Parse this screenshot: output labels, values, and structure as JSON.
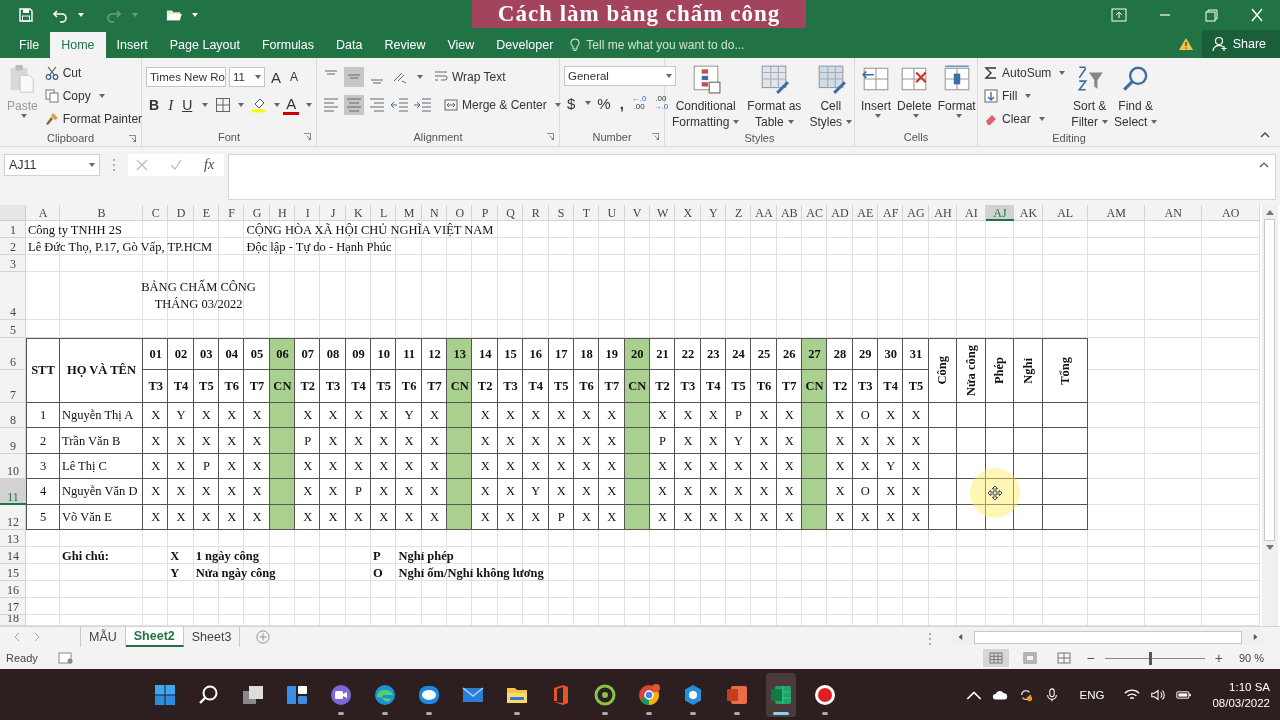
{
  "overlay_title": "Cách làm bảng chấm công",
  "tabs": [
    {
      "label": "File",
      "selected": false
    },
    {
      "label": "Home",
      "selected": true
    },
    {
      "label": "Insert",
      "selected": false
    },
    {
      "label": "Page Layout",
      "selected": false
    },
    {
      "label": "Formulas",
      "selected": false
    },
    {
      "label": "Data",
      "selected": false
    },
    {
      "label": "Review",
      "selected": false
    },
    {
      "label": "View",
      "selected": false
    },
    {
      "label": "Developer",
      "selected": false
    }
  ],
  "tell_me": {
    "placeholder": "Tell me what you want to do..."
  },
  "share": "Share",
  "clipboard": {
    "paste": "Paste",
    "cut": "Cut",
    "copy": "Copy",
    "format_painter": "Format Painter",
    "label": "Clipboard"
  },
  "font": {
    "family": "Times New Ro",
    "size": "11",
    "grow": "A",
    "shrink": "A",
    "bold": "B",
    "italic": "I",
    "underline": "U",
    "font_color_letter": "A",
    "label": "Font"
  },
  "alignment": {
    "vertical": [
      {
        "selected": false
      },
      {
        "selected": true
      },
      {
        "selected": false
      }
    ],
    "horizontal": [
      {
        "selected": false
      },
      {
        "selected": true
      },
      {
        "selected": false
      }
    ],
    "wrap_text": "Wrap Text",
    "merge": "Merge & Center",
    "label": "Alignment"
  },
  "number": {
    "format": "General",
    "currency": "$",
    "percent": "%",
    "comma": ",",
    "increase_decimal": [
      "←.0",
      ".00"
    ],
    "decrease_decimal": [
      ".00",
      "→.0"
    ],
    "label": "Number"
  },
  "styles": {
    "items": [
      {
        "lines": [
          "Conditional",
          "Formatting"
        ]
      },
      {
        "lines": [
          "Format as",
          "Table"
        ]
      },
      {
        "lines": [
          "Cell",
          "Styles"
        ]
      }
    ],
    "label": "Styles"
  },
  "cells": {
    "items": [
      "Insert",
      "Delete",
      "Format"
    ],
    "label": "Cells"
  },
  "editing": {
    "autosum": "AutoSum",
    "fill": "Fill",
    "clear": "Clear",
    "sort": [
      "Sort &",
      "Filter"
    ],
    "find": [
      "Find &",
      "Select"
    ],
    "label": "Editing"
  },
  "formula_bar": {
    "name_box": "AJ11",
    "fx": "fx"
  },
  "columns": [
    {
      "label": "A",
      "selected": false
    },
    {
      "label": "B",
      "selected": false
    },
    {
      "label": "C",
      "selected": false
    },
    {
      "label": "D",
      "selected": false
    },
    {
      "label": "E",
      "selected": false
    },
    {
      "label": "F",
      "selected": false
    },
    {
      "label": "G",
      "selected": false
    },
    {
      "label": "H",
      "selected": false
    },
    {
      "label": "I",
      "selected": false
    },
    {
      "label": "J",
      "selected": false
    },
    {
      "label": "K",
      "selected": false
    },
    {
      "label": "L",
      "selected": false
    },
    {
      "label": "M",
      "selected": false
    },
    {
      "label": "N",
      "selected": false
    },
    {
      "label": "O",
      "selected": false
    },
    {
      "label": "P",
      "selected": false
    },
    {
      "label": "Q",
      "selected": false
    },
    {
      "label": "R",
      "selected": false
    },
    {
      "label": "S",
      "selected": false
    },
    {
      "label": "T",
      "selected": false
    },
    {
      "label": "U",
      "selected": false
    },
    {
      "label": "V",
      "selected": false
    },
    {
      "label": "W",
      "selected": false
    },
    {
      "label": "X",
      "selected": false
    },
    {
      "label": "Y",
      "selected": false
    },
    {
      "label": "Z",
      "selected": false
    },
    {
      "label": "AA",
      "selected": false
    },
    {
      "label": "AB",
      "selected": false
    },
    {
      "label": "AC",
      "selected": false
    },
    {
      "label": "AD",
      "selected": false
    },
    {
      "label": "AE",
      "selected": false
    },
    {
      "label": "AF",
      "selected": false
    },
    {
      "label": "AG",
      "selected": false
    },
    {
      "label": "AH",
      "selected": false
    },
    {
      "label": "AI",
      "selected": false
    },
    {
      "label": "AJ",
      "selected": true
    },
    {
      "label": "AK",
      "selected": false
    },
    {
      "label": "AL",
      "selected": false
    },
    {
      "label": "AM",
      "selected": false
    },
    {
      "label": "AN",
      "selected": false
    },
    {
      "label": "AO",
      "selected": false
    }
  ],
  "rows": [
    {
      "label": "1",
      "selected": false
    },
    {
      "label": "2",
      "selected": false
    },
    {
      "label": "3",
      "selected": false
    },
    {
      "label": "4",
      "selected": false
    },
    {
      "label": "5",
      "selected": false
    },
    {
      "label": "6",
      "selected": false
    },
    {
      "label": "7",
      "selected": false
    },
    {
      "label": "8",
      "selected": false
    },
    {
      "label": "9",
      "selected": false
    },
    {
      "label": "10",
      "selected": false
    },
    {
      "label": "11",
      "selected": true
    },
    {
      "label": "12",
      "selected": false
    },
    {
      "label": "13",
      "selected": false
    },
    {
      "label": "14",
      "selected": false
    },
    {
      "label": "15",
      "selected": false
    },
    {
      "label": "16",
      "selected": false
    },
    {
      "label": "17",
      "selected": false
    },
    {
      "label": "18",
      "selected": false
    }
  ],
  "company": "Công ty TNHH 2S",
  "address": "Lê Đức Thọ, P.17, Gò Vấp, TP.HCM",
  "national_title": "CỘNG HÒA XÃ HỘI CHỦ NGHĨA VIỆT NAM",
  "motto": "Độc lập - Tự do - Hạnh Phúc",
  "sheet_title": "BẢNG CHẤM CÔNG",
  "sheet_month": "THÁNG 03/2022",
  "table_headers": {
    "stt": "STT",
    "name": "HỌ VÀ TÊN",
    "summary": [
      "Công",
      "Nửa công",
      "Phép",
      "Nghỉ",
      "Tổng"
    ]
  },
  "days": [
    {
      "date": "01",
      "weekday": "T3",
      "holiday": false
    },
    {
      "date": "02",
      "weekday": "T4",
      "holiday": false
    },
    {
      "date": "03",
      "weekday": "T5",
      "holiday": false
    },
    {
      "date": "04",
      "weekday": "T6",
      "holiday": false
    },
    {
      "date": "05",
      "weekday": "T7",
      "holiday": false
    },
    {
      "date": "06",
      "weekday": "CN",
      "holiday": true
    },
    {
      "date": "07",
      "weekday": "T2",
      "holiday": false
    },
    {
      "date": "08",
      "weekday": "T3",
      "holiday": false
    },
    {
      "date": "09",
      "weekday": "T4",
      "holiday": false
    },
    {
      "date": "10",
      "weekday": "T5",
      "holiday": false
    },
    {
      "date": "11",
      "weekday": "T6",
      "holiday": false
    },
    {
      "date": "12",
      "weekday": "T7",
      "holiday": false
    },
    {
      "date": "13",
      "weekday": "CN",
      "holiday": true
    },
    {
      "date": "14",
      "weekday": "T2",
      "holiday": false
    },
    {
      "date": "15",
      "weekday": "T3",
      "holiday": false
    },
    {
      "date": "16",
      "weekday": "T4",
      "holiday": false
    },
    {
      "date": "17",
      "weekday": "T5",
      "holiday": false
    },
    {
      "date": "18",
      "weekday": "T6",
      "holiday": false
    },
    {
      "date": "19",
      "weekday": "T7",
      "holiday": false
    },
    {
      "date": "20",
      "weekday": "CN",
      "holiday": true
    },
    {
      "date": "21",
      "weekday": "T2",
      "holiday": false
    },
    {
      "date": "22",
      "weekday": "T3",
      "holiday": false
    },
    {
      "date": "23",
      "weekday": "T4",
      "holiday": false
    },
    {
      "date": "24",
      "weekday": "T5",
      "holiday": false
    },
    {
      "date": "25",
      "weekday": "T6",
      "holiday": false
    },
    {
      "date": "26",
      "weekday": "T7",
      "holiday": false
    },
    {
      "date": "27",
      "weekday": "CN",
      "holiday": true
    },
    {
      "date": "28",
      "weekday": "T2",
      "holiday": false
    },
    {
      "date": "29",
      "weekday": "T3",
      "holiday": false
    },
    {
      "date": "30",
      "weekday": "T4",
      "holiday": false
    },
    {
      "date": "31",
      "weekday": "T5",
      "holiday": false
    }
  ],
  "employees": [
    {
      "stt": "1",
      "name": "Nguyễn Thị A",
      "marks": [
        "X",
        "Y",
        "X",
        "X",
        "X",
        "X",
        "X",
        "X",
        "X",
        "Y",
        "X",
        "X",
        "X",
        "X",
        "X",
        "X",
        "X",
        "X",
        "X",
        "X",
        "P",
        "X",
        "X",
        "X",
        "O",
        "X",
        "X"
      ]
    },
    {
      "stt": "2",
      "name": "Trần Văn B",
      "marks": [
        "X",
        "X",
        "X",
        "X",
        "X",
        "P",
        "X",
        "X",
        "X",
        "X",
        "X",
        "X",
        "X",
        "X",
        "X",
        "X",
        "X",
        "P",
        "X",
        "X",
        "Y",
        "X",
        "X",
        "X",
        "X",
        "X",
        "X"
      ]
    },
    {
      "stt": "3",
      "name": "Lê Thị C",
      "marks": [
        "X",
        "X",
        "P",
        "X",
        "X",
        "X",
        "X",
        "X",
        "X",
        "X",
        "X",
        "X",
        "X",
        "X",
        "X",
        "X",
        "X",
        "X",
        "X",
        "X",
        "X",
        "X",
        "X",
        "X",
        "X",
        "Y",
        "X"
      ]
    },
    {
      "stt": "4",
      "name": "Nguyễn Văn D",
      "marks": [
        "X",
        "X",
        "X",
        "X",
        "X",
        "X",
        "X",
        "P",
        "X",
        "X",
        "X",
        "X",
        "X",
        "Y",
        "X",
        "X",
        "X",
        "X",
        "X",
        "X",
        "X",
        "X",
        "X",
        "X",
        "O",
        "X",
        "X"
      ]
    },
    {
      "stt": "5",
      "name": "Võ Văn E",
      "marks": [
        "X",
        "X",
        "X",
        "X",
        "X",
        "X",
        "X",
        "X",
        "X",
        "X",
        "X",
        "X",
        "X",
        "X",
        "P",
        "X",
        "X",
        "X",
        "X",
        "X",
        "X",
        "X",
        "X",
        "X",
        "X",
        "X",
        "X"
      ]
    }
  ],
  "legend": {
    "title": "Ghi chú:",
    "items": [
      {
        "code": "X",
        "text": "1 ngày công"
      },
      {
        "code": "Y",
        "text": "Nửa ngày công"
      },
      {
        "code": "P",
        "text": "Nghỉ phép"
      },
      {
        "code": "O",
        "text": "Nghỉ ốm/Nghỉ không lương"
      }
    ]
  },
  "sheet_tabs": [
    {
      "label": "MẪU",
      "selected": false
    },
    {
      "label": "Sheet2",
      "selected": true
    },
    {
      "label": "Sheet3",
      "selected": false
    }
  ],
  "status": {
    "text": "Ready",
    "views": [
      {
        "selected": true
      },
      {
        "selected": false
      },
      {
        "selected": false
      }
    ],
    "zoom_out": "−",
    "zoom_in": "+",
    "level": 0.45,
    "zoom": "90 %"
  },
  "taskbar": {
    "apps": [
      {
        "kind": "start",
        "running": false,
        "active": false
      },
      {
        "kind": "search",
        "running": false,
        "active": false
      },
      {
        "kind": "taskview",
        "running": false,
        "active": false
      },
      {
        "kind": "widgets",
        "running": false,
        "active": false
      },
      {
        "kind": "chat",
        "running": true,
        "active": false
      },
      {
        "kind": "edge",
        "running": true,
        "active": false
      },
      {
        "kind": "zalo",
        "running": true,
        "active": false
      },
      {
        "kind": "mail",
        "running": false,
        "active": false
      },
      {
        "kind": "explorer",
        "running": true,
        "active": false
      },
      {
        "kind": "office",
        "running": false,
        "active": false
      },
      {
        "kind": "greenapp",
        "running": true,
        "active": false
      },
      {
        "kind": "chrome",
        "running": true,
        "active": false
      },
      {
        "kind": "gearapp",
        "running": true,
        "active": false
      },
      {
        "kind": "powerpoint",
        "running": true,
        "active": false
      },
      {
        "kind": "excel",
        "running": true,
        "active": true
      },
      {
        "kind": "record",
        "running": true,
        "active": false
      }
    ],
    "language": "ENG",
    "time": "1:10 SA",
    "date": "08/03/2022"
  }
}
